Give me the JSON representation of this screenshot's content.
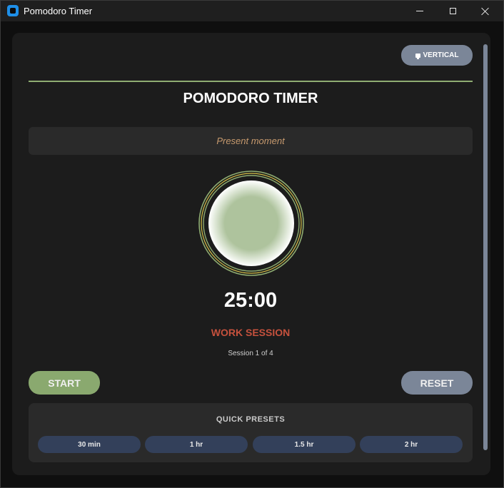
{
  "window": {
    "title": "Pomodoro Timer"
  },
  "toolbar": {
    "layout_label": "VERTICAL"
  },
  "main": {
    "title": "POMODORO TIMER",
    "quote": "Present moment",
    "time": "25:00",
    "session_type": "WORK SESSION",
    "session_count": "Session 1 of 4"
  },
  "controls": {
    "start_label": "START",
    "reset_label": "RESET"
  },
  "presets": {
    "title": "QUICK PRESETS",
    "items": [
      {
        "label": "30 min"
      },
      {
        "label": "1 hr"
      },
      {
        "label": "1.5 hr"
      },
      {
        "label": "2 hr"
      }
    ]
  },
  "colors": {
    "accent_green": "#8aa96f",
    "work_red": "#c5513d",
    "slate": "#7b8698",
    "preset_blue": "#33405a",
    "quote_tan": "#c79a6e"
  },
  "icons": {
    "app": "app-icon",
    "layout": "monitor-icon"
  }
}
